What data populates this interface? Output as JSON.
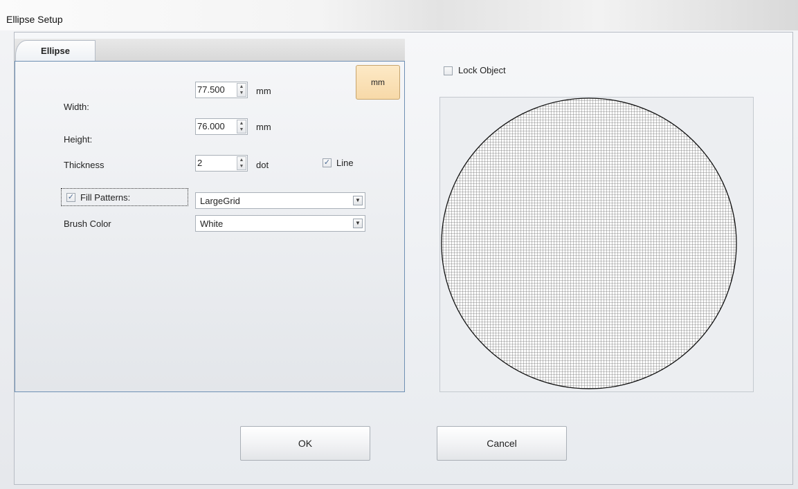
{
  "window": {
    "title": "Ellipse Setup"
  },
  "tabs": [
    {
      "label": "Ellipse"
    }
  ],
  "units_button": {
    "label": "mm"
  },
  "fields": {
    "width": {
      "label": "Width:",
      "value": "77.500",
      "unit": "mm"
    },
    "height": {
      "label": "Height:",
      "value": "76.000",
      "unit": "mm"
    },
    "thickness": {
      "label": "Thickness",
      "value": "2",
      "unit": "dot"
    }
  },
  "line_checkbox": {
    "label": "Line",
    "checked": true
  },
  "fill_patterns": {
    "label": "Fill Patterns:",
    "checked": true,
    "selected": "LargeGrid"
  },
  "brush_color": {
    "label": "Brush Color",
    "selected": "White"
  },
  "lock_object": {
    "label": "Lock Object",
    "checked": false
  },
  "buttons": {
    "ok": "OK",
    "cancel": "Cancel"
  },
  "icons": {
    "spin": "up-down-arrows-icon",
    "dropdown": "chevron-down-icon",
    "check": "checkmark-icon"
  }
}
